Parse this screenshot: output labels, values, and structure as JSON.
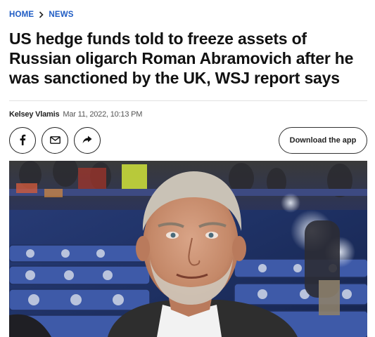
{
  "breadcrumb": {
    "home": "HOME",
    "section": "NEWS"
  },
  "article": {
    "headline": "US hedge funds told to freeze assets of Russian oligarch Roman Abramovich after he was sanctioned by the UK, WSJ report says",
    "author": "Kelsey Vlamis",
    "date": "Mar 11, 2022, 10:13 PM"
  },
  "actions": {
    "download_app": "Download the app"
  },
  "icons": {
    "breadcrumb_separator": "chevron-right-icon",
    "share_facebook": "facebook-icon",
    "share_email": "mail-icon",
    "share_forward": "share-arrow-icon"
  },
  "colors": {
    "link": "#1f5cc4",
    "text": "#111111",
    "border": "#222222"
  }
}
